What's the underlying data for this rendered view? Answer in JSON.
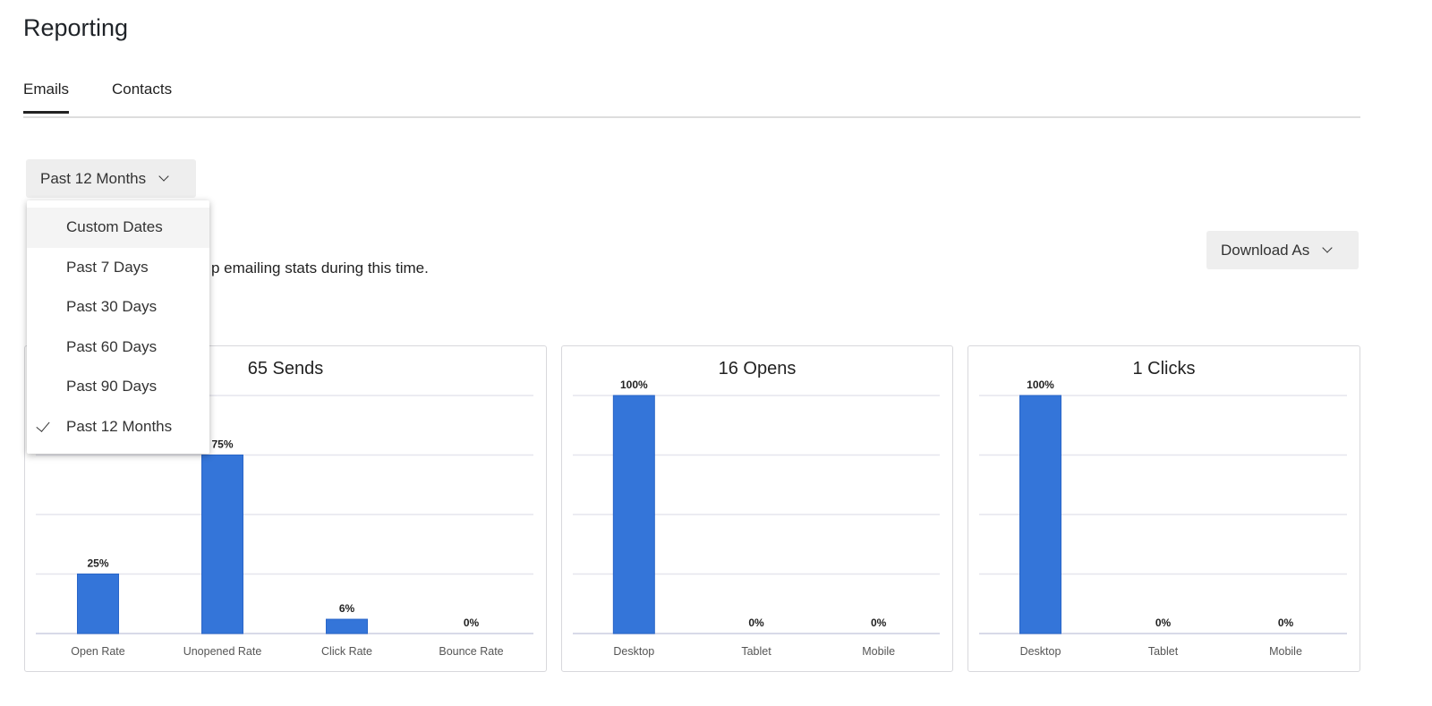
{
  "page_title": "Reporting",
  "tabs": [
    {
      "label": "Emails",
      "active": true
    },
    {
      "label": "Contacts",
      "active": false
    }
  ],
  "date_range": {
    "selected": "Past 12 Months",
    "options": [
      "Custom Dates",
      "Past 7 Days",
      "Past 30 Days",
      "Past 60 Days",
      "Past 90 Days",
      "Past 12 Months"
    ]
  },
  "subtitle_visible": "p emailing stats during this time.",
  "download_label": "Download As",
  "colors": {
    "bar": "#3475d9",
    "grid": "#e6e6ee"
  },
  "chart_data": [
    {
      "type": "bar",
      "title": "65 Sends",
      "categories": [
        "Open Rate",
        "Unopened Rate",
        "Click Rate",
        "Bounce Rate"
      ],
      "values": [
        25,
        75,
        6,
        0
      ],
      "labels": [
        "25%",
        "75%",
        "6%",
        "0%"
      ],
      "ylim": [
        0,
        100
      ],
      "grid": true
    },
    {
      "type": "bar",
      "title": "16 Opens",
      "categories": [
        "Desktop",
        "Tablet",
        "Mobile"
      ],
      "values": [
        100,
        0,
        0
      ],
      "labels": [
        "100%",
        "0%",
        "0%"
      ],
      "ylim": [
        0,
        100
      ],
      "grid": true
    },
    {
      "type": "bar",
      "title": "1 Clicks",
      "categories": [
        "Desktop",
        "Tablet",
        "Mobile"
      ],
      "values": [
        100,
        0,
        0
      ],
      "labels": [
        "100%",
        "0%",
        "0%"
      ],
      "ylim": [
        0,
        100
      ],
      "grid": true
    }
  ]
}
